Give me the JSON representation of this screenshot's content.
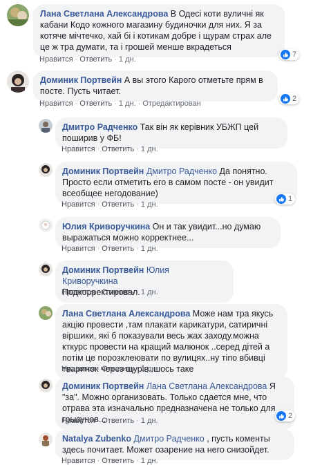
{
  "comments": [
    {
      "author": "Лана Светлана Александрова",
      "text": " В Одесі коти вуличні як кабани Кодо кожного магазину будиночки для них. Я за котяче мічтечко, хай бі і котикам добре і щурам страх але це ж тра думати, та і грошей менше вкрадеться",
      "like": "Нравится",
      "reply": "Ответить",
      "time": "1 дн.",
      "reactions": "7"
    },
    {
      "author": "Доминик Портвейн",
      "text": " А вы этого Карого отметьте прям в посте. Пусть читает.",
      "like": "Нравится",
      "reply": "Ответить",
      "time": "1 дн.",
      "edited": "Отредактирован",
      "reactions": "2"
    },
    {
      "author": "Дмитро Радченко",
      "text": " Так він як керівник УБЖП цей поширив у ФБ!",
      "like": "Нравится",
      "reply": "Ответить",
      "time": "1 дн."
    },
    {
      "author": "Доминик Портвейн",
      "mention": "Дмитро Радченко",
      "text": " Да понятно. Просто если отметить его в самом посте - он увидит всеобщее негодование)",
      "like": "Нравится",
      "reply": "Ответить",
      "time": "1 дн.",
      "reactions": "1"
    },
    {
      "author": "Юлия Криворучкина",
      "text": " Он и так увидит...но думаю выражаться можно корректнее...",
      "like": "Нравится",
      "reply": "Ответить",
      "time": "1 дн."
    },
    {
      "author": "Доминик Портвейн",
      "mention": "Юлия Криворучкина",
      "text": "Подкорректировал.",
      "like": "Нравится",
      "reply": "Ответить",
      "time": "1 дн."
    },
    {
      "author": "Лана Светлана Александрова",
      "text": " Може нам тра якусь акцію провести ,там плакати карикатури, сатиричні віршики, які б показували весь жах заходу.можна кткурс провести на кращий малюнок ..серед дітей а потім це порозклеювати по вулицях..ну тіпо вбивці тваринок через щурів..шось таке",
      "like": "Нравится",
      "reply": "Ответить",
      "time": "1 дн."
    },
    {
      "author": "Доминик Портвейн",
      "mention": "Лана Светлана Александрова",
      "text": " Я \"за\". Можно организовать. Только сдается мне, что отрава эта изначально предназначена не только для грызунов...",
      "like": "Нравится",
      "reply": "Ответить",
      "time": "1 дн.",
      "reactions": "2"
    },
    {
      "author": "Natalya Zubenko",
      "mention": "Дмитро Радченко",
      "text": " , пусть коменты здесь почитает. Может озарение на него снизойдет.",
      "like": "Нравится",
      "reply": "Ответить",
      "time": "1 дн."
    }
  ],
  "colors": {
    "link": "#385898",
    "bubble": "#f2f3f5",
    "like_blue": "#1877f2"
  }
}
